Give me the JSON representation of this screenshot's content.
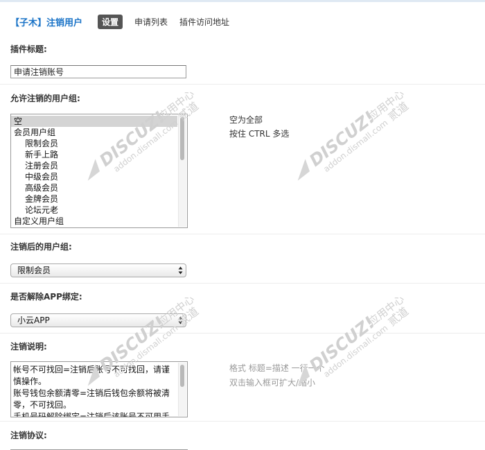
{
  "header": {
    "plugin_title": "【子木】注销用户",
    "tabs": [
      {
        "label": "设置",
        "active": true
      },
      {
        "label": "申请列表",
        "active": false
      },
      {
        "label": "插件访问地址",
        "active": false
      }
    ]
  },
  "fields": {
    "plugin_title": {
      "label": "插件标题:",
      "value": "申请注销账号"
    },
    "allowed_groups": {
      "label": "允许注销的用户组:",
      "options": [
        {
          "label": "空",
          "selected": true,
          "indent": false
        },
        {
          "label": "会员用户组",
          "selected": false,
          "indent": false
        },
        {
          "label": "限制会员",
          "selected": false,
          "indent": true
        },
        {
          "label": "新手上路",
          "selected": false,
          "indent": true
        },
        {
          "label": "注册会员",
          "selected": false,
          "indent": true
        },
        {
          "label": "中级会员",
          "selected": false,
          "indent": true
        },
        {
          "label": "高级会员",
          "selected": false,
          "indent": true
        },
        {
          "label": "金牌会员",
          "selected": false,
          "indent": true
        },
        {
          "label": "论坛元老",
          "selected": false,
          "indent": true
        },
        {
          "label": "自定义用户组",
          "selected": false,
          "indent": false
        }
      ],
      "hint_lines": [
        "空为全部",
        "按住 CTRL 多选"
      ]
    },
    "after_group": {
      "label": "注销后的用户组:",
      "value": "限制会员"
    },
    "unbind_app": {
      "label": "是否解除APP绑定:",
      "value": "小云APP"
    },
    "description": {
      "label": "注销说明:",
      "value": "帐号不可找回=注销后账号不可找回，请谨慎操作。\n账号钱包余额清零=注销后钱包余额将被清零，不可找回。\n手机号码解除绑定=注销后该账号不可用手",
      "hint_lines": [
        "格式 标题=描述 一行一个",
        "双击输入框可扩大/缩小"
      ]
    },
    "agreement": {
      "label": "注销协议:"
    }
  },
  "watermark": {
    "brand": "DISCUZ!",
    "cn": "应用中心",
    "domain": "addon.dismall.com",
    "partner": "贰道",
    "reg": "®"
  },
  "colors": {
    "accent": "#1a73c7",
    "active_tab": "#555555"
  }
}
